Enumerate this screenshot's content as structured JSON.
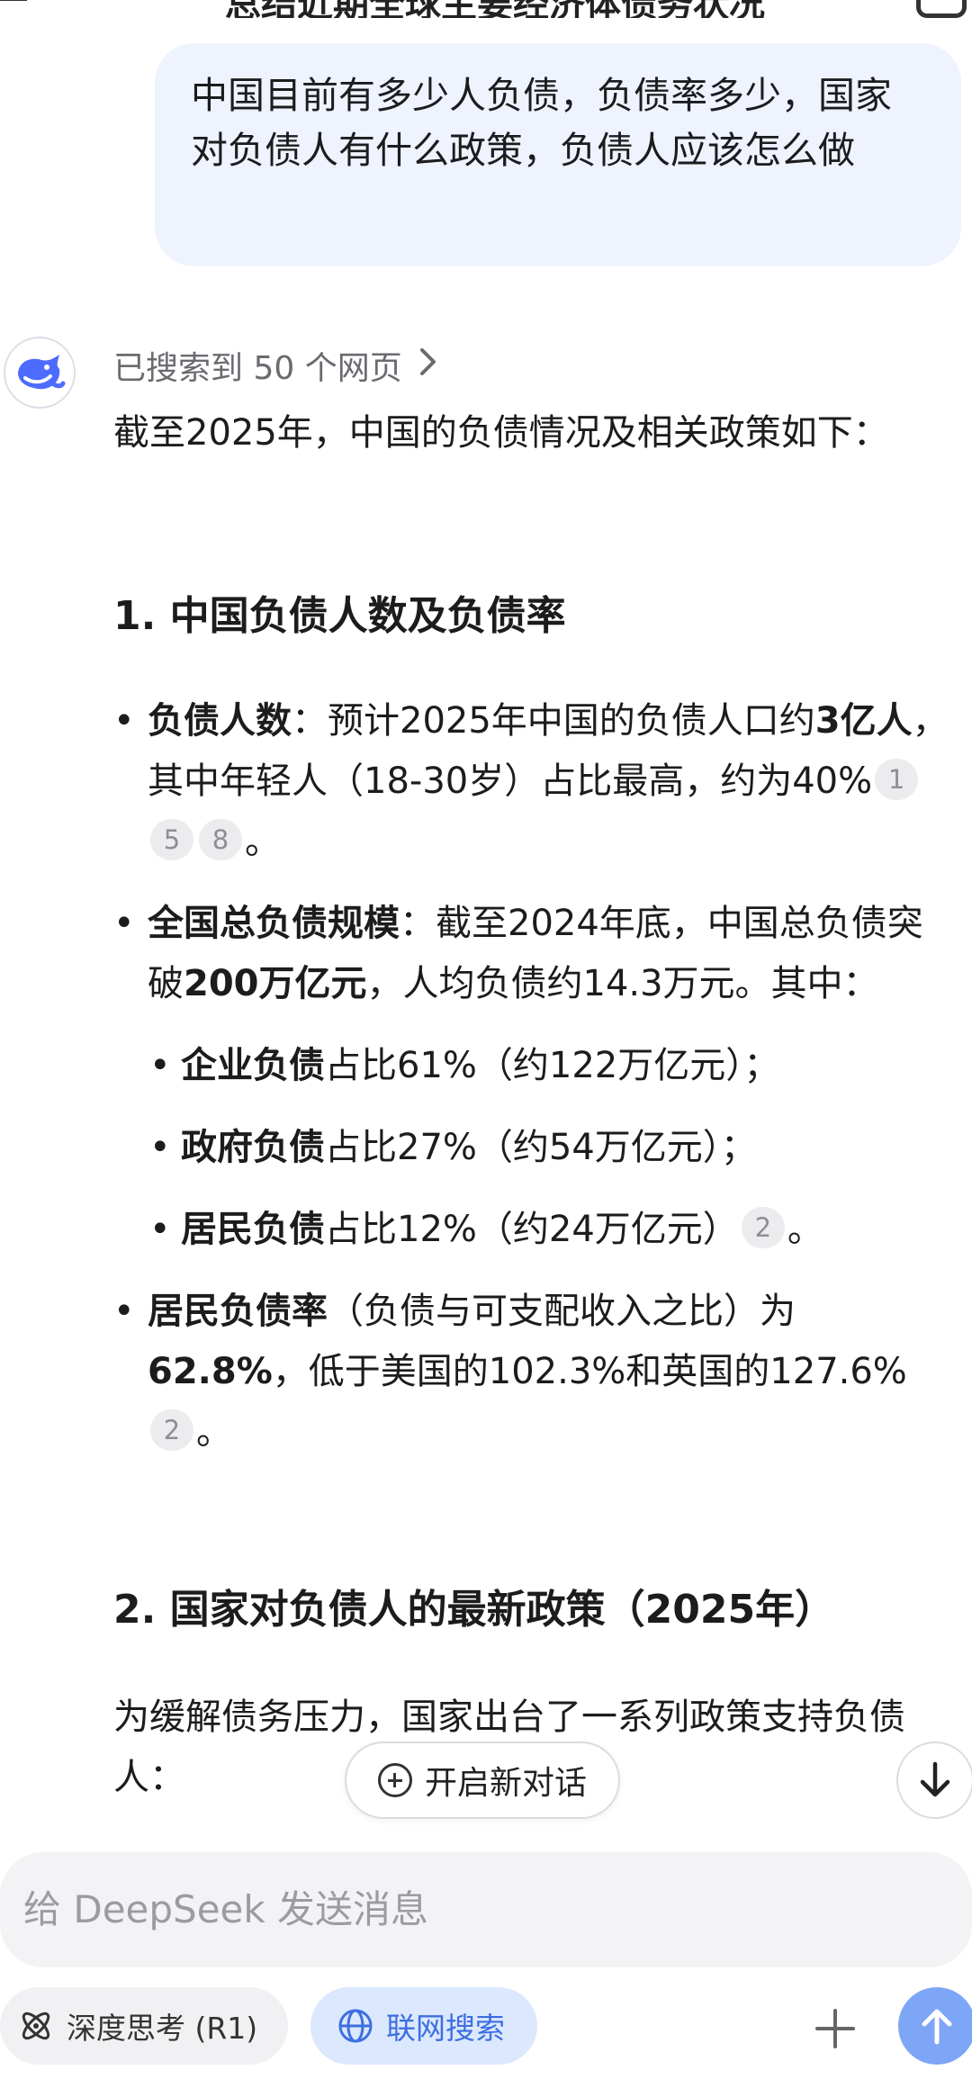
{
  "header": {
    "title": "总结近期全球主要经济体债务状况"
  },
  "user_message": "中国目前有多少人负债，负债率多少，国家对负债人有什么政策，负债人应该怎么做",
  "assistant": {
    "search_summary": "已搜索到 50 个网页",
    "intro": "截至2025年，中国的负债情况及相关政策如下：",
    "section1": {
      "heading": "1. 中国负债人数及负债率",
      "b1_label": "负债人数",
      "b1_text1": "：预计2025年中国的负债人口约",
      "b1_bold": "3亿人",
      "b1_text2": "，其中年轻人（18-30岁）占比最高，约为40%",
      "b1_cites": [
        "1",
        "5",
        "8"
      ],
      "b1_end": "。",
      "b2_label": "全国总负债规模",
      "b2_text1": "：截至2024年底，中国总负债突破",
      "b2_bold": "200万亿元",
      "b2_text2": "，人均负债约14.3万元。其中：",
      "sub1_label": "企业负债",
      "sub1_text": "占比61%（约122万亿元）；",
      "sub2_label": "政府负债",
      "sub2_text": "占比27%（约54万亿元）；",
      "sub3_label": "居民负债",
      "sub3_text": "占比12%（约24万亿元）",
      "sub3_cite": "2",
      "sub3_end": "。",
      "b3_label": "居民负债率",
      "b3_text1": "（负债与可支配收入之比）为",
      "b3_bold": "62.8%",
      "b3_text2": "，低于美国的102.3%和英国的127.6%",
      "b3_cite": "2",
      "b3_end": "。"
    },
    "section2": {
      "heading": "2. 国家对负债人的最新政策（2025年）",
      "intro": "为缓解债务压力，国家出台了一系列政策支持负债人："
    }
  },
  "floating": {
    "new_chat_label": "开启新对话"
  },
  "composer": {
    "placeholder": "给 DeepSeek 发送消息"
  },
  "toolbar": {
    "deep_think_label": "深度思考 (R1)",
    "web_search_label": "联网搜索"
  },
  "colors": {
    "accent": "#4d6bfe",
    "bubble": "#eef3fd",
    "send": "#7ea6f7",
    "web_chip_bg": "#dbe8fd",
    "web_chip_text": "#3d6fe0"
  }
}
